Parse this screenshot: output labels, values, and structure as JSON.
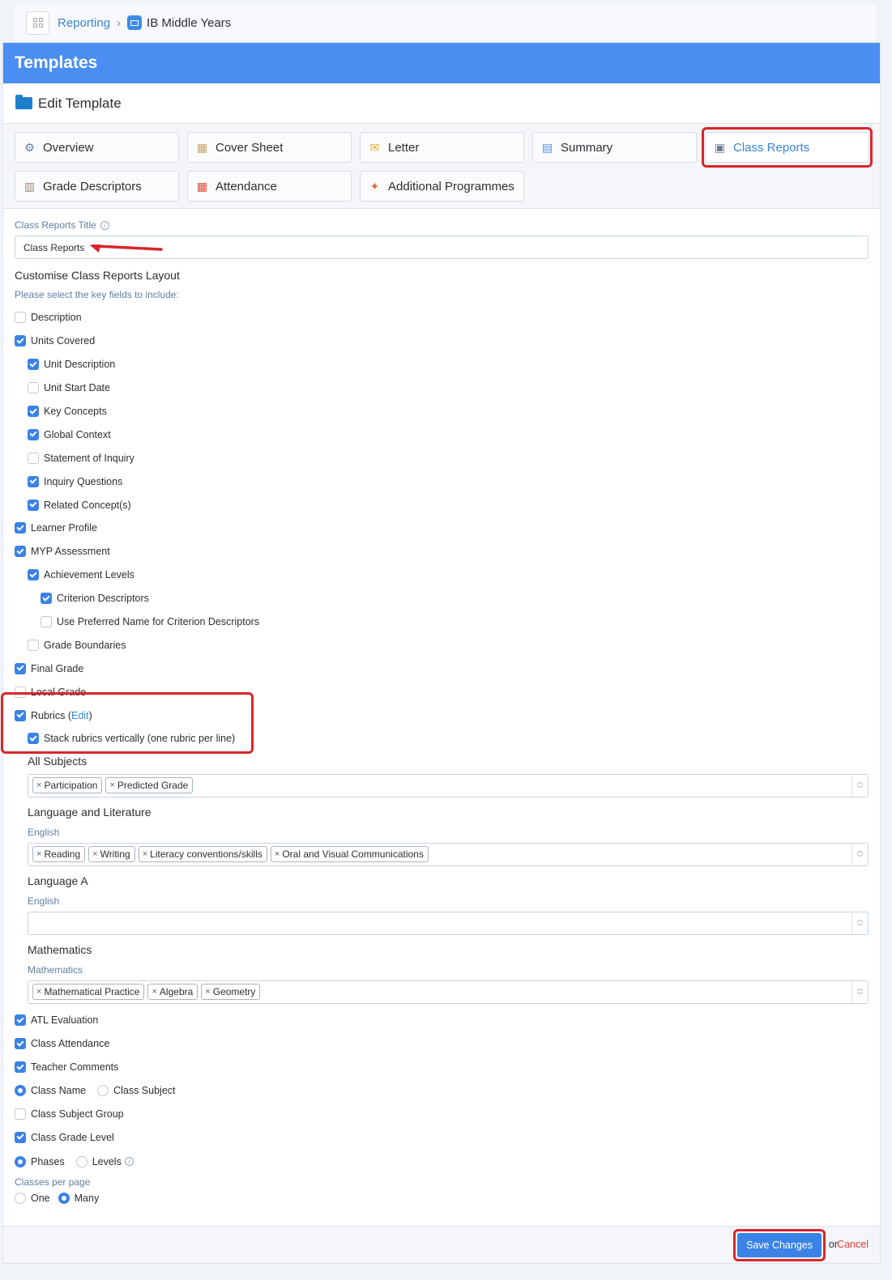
{
  "breadcrumb": {
    "parent": "Reporting",
    "current": "IB Middle Years"
  },
  "header": {
    "title": "Templates"
  },
  "edit": {
    "title": "Edit Template"
  },
  "tabs": [
    {
      "label": "Overview",
      "icon": "gear-icon",
      "active": false
    },
    {
      "label": "Cover Sheet",
      "icon": "map-icon",
      "active": false
    },
    {
      "label": "Letter",
      "icon": "envelope-icon",
      "active": false
    },
    {
      "label": "Summary",
      "icon": "chart-icon",
      "active": false
    },
    {
      "label": "Class Reports",
      "icon": "report-card-icon",
      "active": true
    },
    {
      "label": "Grade Descriptors",
      "icon": "document-icon",
      "active": false
    },
    {
      "label": "Attendance",
      "icon": "calendar-icon",
      "active": false
    },
    {
      "label": "Additional Programmes",
      "icon": "puzzle-icon",
      "active": false
    }
  ],
  "form": {
    "title_label": "Class Reports Title",
    "title_value": "Class Reports",
    "layout_heading": "Customise Class Reports Layout",
    "hint": "Please select the key fields to include:"
  },
  "fields": [
    {
      "label": "Description",
      "level": 0,
      "checked": false
    },
    {
      "label": "Units Covered",
      "level": 0,
      "checked": true
    },
    {
      "label": "Unit Description",
      "level": 1,
      "checked": true
    },
    {
      "label": "Unit Start Date",
      "level": 1,
      "checked": false
    },
    {
      "label": "Key Concepts",
      "level": 1,
      "checked": true
    },
    {
      "label": "Global Context",
      "level": 1,
      "checked": true
    },
    {
      "label": "Statement of Inquiry",
      "level": 1,
      "checked": false
    },
    {
      "label": "Inquiry Questions",
      "level": 1,
      "checked": true
    },
    {
      "label": "Related Concept(s)",
      "level": 1,
      "checked": true
    },
    {
      "label": "Learner Profile",
      "level": 0,
      "checked": true
    },
    {
      "label": "MYP Assessment",
      "level": 0,
      "checked": true
    },
    {
      "label": "Achievement Levels",
      "level": 1,
      "checked": true
    },
    {
      "label": "Criterion Descriptors",
      "level": 2,
      "checked": true
    },
    {
      "label": "Use Preferred Name for Criterion Descriptors",
      "level": 2,
      "checked": false
    },
    {
      "label": "Grade Boundaries",
      "level": 1,
      "checked": false
    },
    {
      "label": "Final Grade",
      "level": 0,
      "checked": true
    },
    {
      "label": "Local Grade",
      "level": 0,
      "checked": false
    }
  ],
  "rubrics": {
    "label": "Rubrics (",
    "edit_link": "Edit",
    "close": ")",
    "checked": true,
    "stack_label": "Stack rubrics vertically (one rubric per line)",
    "stack_checked": true
  },
  "subjects": [
    {
      "title": "All Subjects",
      "sub": "",
      "tags": [
        "Participation",
        "Predicted Grade"
      ]
    },
    {
      "title": "Language and Literature",
      "sub": "English",
      "tags": [
        "Reading",
        "Writing",
        "Literacy conventions/skills",
        "Oral and Visual Communications"
      ]
    },
    {
      "title": "Language A",
      "sub": "English",
      "tags": []
    },
    {
      "title": "Mathematics",
      "sub": "Mathematics",
      "tags": [
        "Mathematical Practice",
        "Algebra",
        "Geometry"
      ]
    }
  ],
  "more_fields": [
    {
      "label": "ATL Evaluation",
      "checked": true
    },
    {
      "label": "Class Attendance",
      "checked": true
    },
    {
      "label": "Teacher Comments",
      "checked": true
    }
  ],
  "class_name_radio": {
    "option_a": "Class Name",
    "option_b": "Class Subject",
    "selected": "a"
  },
  "group_fields": [
    {
      "label": "Class Subject Group",
      "checked": false
    },
    {
      "label": "Class Grade Level",
      "checked": true
    }
  ],
  "phase_radio": {
    "option_a": "Phases",
    "option_b": "Levels",
    "selected": "a"
  },
  "per_page": {
    "label": "Classes per page",
    "option_a": "One",
    "option_b": "Many",
    "selected": "b"
  },
  "footer": {
    "save": "Save Changes",
    "or": "or",
    "cancel": "Cancel"
  },
  "colors": {
    "accent": "#4a8ef2",
    "highlight": "#d9262b",
    "cancel": "#e0403a"
  }
}
